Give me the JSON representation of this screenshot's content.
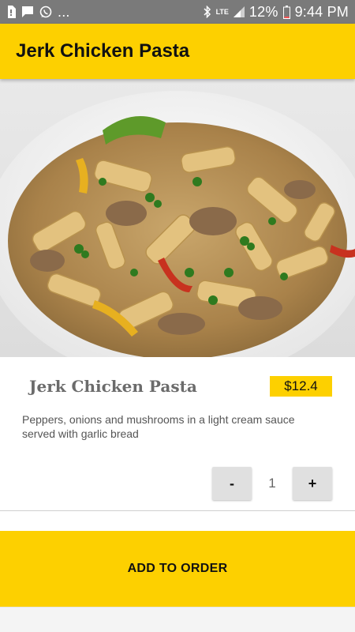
{
  "status_bar": {
    "overflow": "...",
    "network": "LTE",
    "battery": "12%",
    "time": "9:44 PM",
    "icons": [
      "sim-icon",
      "message-icon",
      "whatsapp-icon",
      "bluetooth-icon",
      "signal-icon",
      "battery-icon"
    ]
  },
  "header": {
    "title": "Jerk Chicken Pasta"
  },
  "hero_image": {
    "subject": "food-photo"
  },
  "item": {
    "name": "Jerk Chicken Pasta",
    "price": "$12.4",
    "description": "Peppers, onions and mushrooms in a light cream sauce served with garlic bread"
  },
  "quantity": {
    "decrement_label": "-",
    "value": "1",
    "increment_label": "+"
  },
  "actions": {
    "add_to_order_label": "ADD TO ORDER"
  },
  "colors": {
    "accent": "#fdd000",
    "status_bar": "#7a7a7a",
    "quantity_button": "#e0e0e0"
  }
}
